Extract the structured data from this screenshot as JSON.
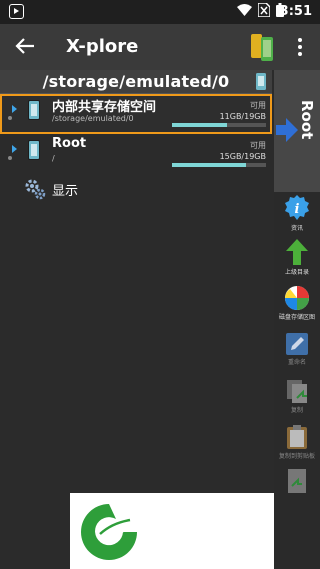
{
  "status_bar": {
    "time": "3:51"
  },
  "toolbar": {
    "title": "X-plore"
  },
  "path_bar": {
    "path": "/storage/emulated/0"
  },
  "storage_list": [
    {
      "name": "内部共享存储空间",
      "path": "/storage/emulated/0",
      "avail_label": "可用",
      "size": "11GB/19GB",
      "fill": 0.58
    },
    {
      "name": "Root",
      "path": "/",
      "avail_label": "可用",
      "size": "15GB/19GB",
      "fill": 0.79
    }
  ],
  "display_item": {
    "label": "显示"
  },
  "right_pane": {
    "label": "Root"
  },
  "sidebar": [
    {
      "label": "资讯",
      "icon": "info-icon",
      "enabled": true
    },
    {
      "label": "上级目录",
      "icon": "up-arrow-icon",
      "enabled": true
    },
    {
      "label": "磁盘存储区图",
      "icon": "pie-chart-icon",
      "enabled": true
    },
    {
      "label": "重命名",
      "icon": "rename-icon",
      "enabled": false
    },
    {
      "label": "复制",
      "icon": "copy-icon",
      "enabled": false
    },
    {
      "label": "复制到剪贴板",
      "icon": "clipboard-icon",
      "enabled": false
    }
  ],
  "colors": {
    "selection": "#f09a1a",
    "accent": "#3fa5e8",
    "bar": "#7fd6d6",
    "logo": "#2e9e3a"
  }
}
